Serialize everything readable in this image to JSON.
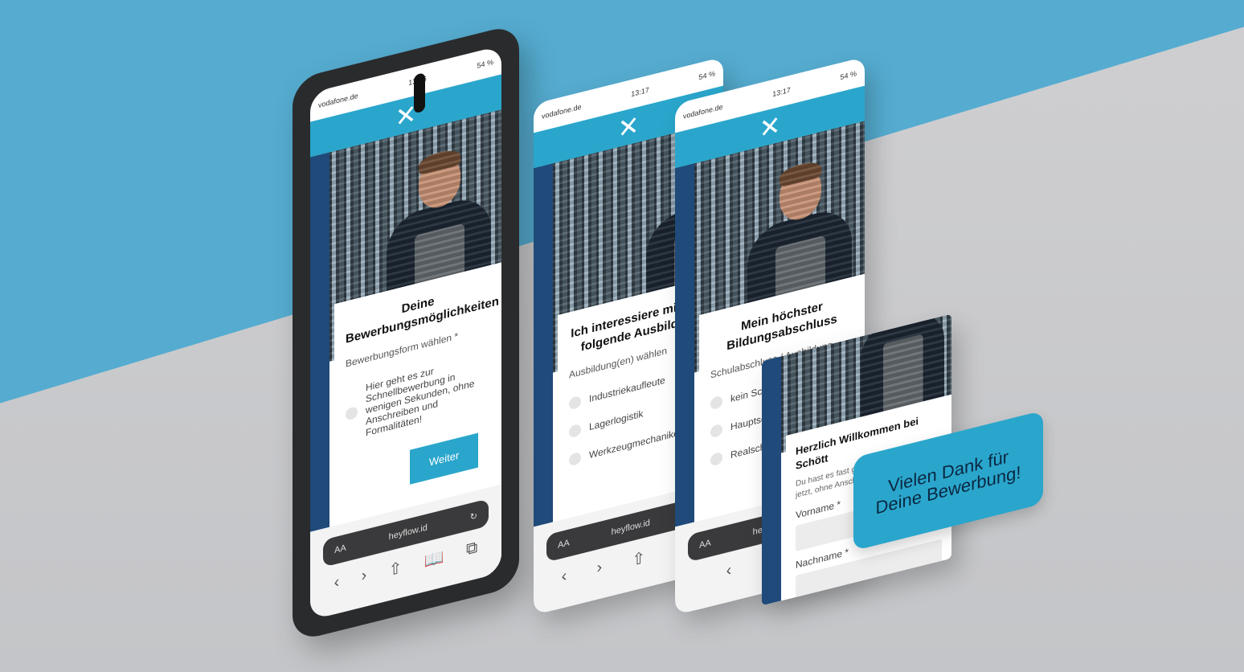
{
  "status": {
    "carrier": "vodafone.de",
    "battery": "54 %"
  },
  "phones": [
    {
      "time": "13:16",
      "close": "✕",
      "card_title": "Deine Bewerbungsmöglichkeiten",
      "card_subtitle": "Bewerbungsform wählen *",
      "options": [
        "Hier geht es zur Schnellbewerbung in wenigen Sekunden, ohne Anschreiben und Formalitäten!"
      ],
      "button": "Weiter",
      "url": "heyflow.id",
      "nav": {
        "text_size": "AA",
        "back": "‹",
        "forward": "›",
        "share": "⇧",
        "bookmarks": "📖",
        "tabs": "⧉"
      }
    },
    {
      "time": "13:17",
      "close": "✕",
      "card_title": "Ich interessiere mich für folgende Ausbildung",
      "card_subtitle": "Ausbildung(en) wählen",
      "options": [
        "Industriekaufleute",
        "Lagerlogistik",
        "Werkzeugmechaniker"
      ],
      "url": "heyflow.id",
      "nav": {
        "text_size": "AA",
        "back": "‹",
        "forward": "›",
        "share": "⇧",
        "bookmarks": "📖"
      }
    },
    {
      "time": "13:17",
      "close": "✕",
      "card_title": "Mein höchster Bildungsabschluss",
      "card_subtitle": "Schulabschluss / Ausbildung",
      "options": [
        "kein Schulabschluss",
        "Hauptschulabschluss",
        "Realschulabschluss"
      ],
      "url": "heyflow.id",
      "nav": {
        "text_size": "AA",
        "back": "‹",
        "forward": "›"
      }
    }
  ],
  "welcome": {
    "title": "Herzlich Willkommen bei Schött",
    "intro": "Du hast es fast geschafft! Bewirb dich jetzt, ohne Anschreiben.",
    "fields": [
      {
        "label": "Vorname *"
      },
      {
        "label": "Nachname *"
      }
    ]
  },
  "badge": {
    "text": "Vielen Dank für Deine Bewerbung!"
  }
}
